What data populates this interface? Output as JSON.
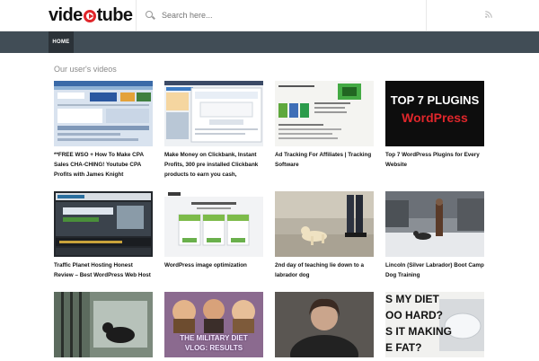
{
  "header": {
    "logo_prefix": "vide",
    "logo_suffix": "tube",
    "search_placeholder": "Search here..."
  },
  "nav": {
    "home_label": "HOME"
  },
  "section": {
    "title": "Our user's videos"
  },
  "videos": [
    {
      "title": "**FREE WSO + How To Make CPA Sales CHA-CHING! Youtube CPA Profits with James Knight"
    },
    {
      "title": "Make Money on Clickbank, Instant Profits, 300 pre installed Clickbank products to earn you cash,"
    },
    {
      "title": "Ad Tracking For Affiliates | Tracking Software"
    },
    {
      "title": "Top 7 WordPress Plugins for Every Website",
      "thumb_line1": "TOP 7 PLUGINS",
      "thumb_line2": "WordPress"
    },
    {
      "title": "Traffic Planet Hosting Honest Review – Best WordPress Web Host"
    },
    {
      "title": "WordPress image optimization"
    },
    {
      "title": "2nd day of teaching lie down to a labrador dog"
    },
    {
      "title": "Lincoln (Silver Labrador) Boot Camp Dog Training"
    },
    {
      "title": ""
    },
    {
      "title": "",
      "thumb_line1": "THE MILITARY DIET",
      "thumb_line2": "VLOG: RESULTS"
    },
    {
      "title": ""
    },
    {
      "title": "",
      "thumb_lines": [
        "S MY DIET",
        "OO HARD?",
        "S IT MAKING",
        "E FAT?"
      ]
    }
  ]
}
